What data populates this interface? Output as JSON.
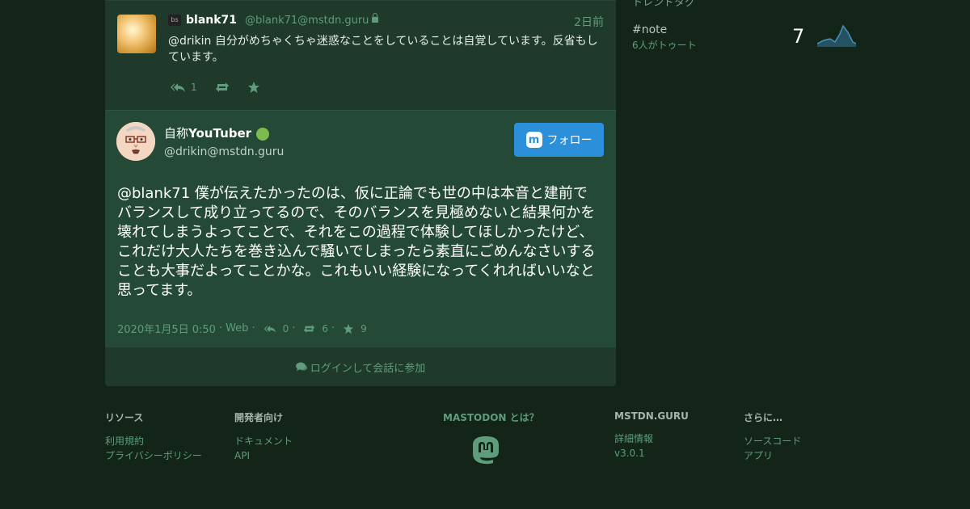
{
  "sidebar": {
    "trend_header": "トレンドタグ",
    "trend": {
      "tag": "#note",
      "sub": "6人がトゥート",
      "count": "7"
    }
  },
  "prev_status": {
    "badge": "bs",
    "display_name": "blank71",
    "acct": "@blank71@mstdn.guru",
    "time": "2日前",
    "content": "@drikin 自分がめちゃくちゃ迷惑なことをしていることは自覚しています。反省もしています。",
    "reply_count": "1"
  },
  "detailed_status": {
    "display_name_prefix": "自称",
    "display_name_bold": "YouTuber",
    "acct": "@drikin@mstdn.guru",
    "follow_label": "フォロー",
    "content": "@blank71 僕が伝えたかったのは、仮に正論でも世の中は本音と建前でバランスして成り立ってるので、そのバランスを見極めないと結果何かを壊れてしまうよってことで、それをこの過程で体験してほしかったけど、これだけ大人たちを巻き込んで騒いでしまったら素直にごめんなさいすることも大事だよってことかな。これもいい経験になってくれればいいなと思ってます。",
    "datetime": "2020年1月5日 0:50",
    "app": "Web",
    "replies": "0",
    "boosts": "6",
    "favourites": "9"
  },
  "login_bar": {
    "label": "ログインして会話に参加"
  },
  "footer": {
    "resources": {
      "title": "リソース",
      "links": [
        "利用規約",
        "プライバシーポリシー"
      ]
    },
    "developers": {
      "title": "開発者向け",
      "links": [
        "ドキュメント",
        "API"
      ]
    },
    "mastodon": {
      "title": "MASTODON とは？"
    },
    "instance": {
      "title": "MSTDN.GURU",
      "links": [
        "詳細情報",
        "v3.0.1"
      ]
    },
    "more": {
      "title": "さらに…",
      "links": [
        "ソースコード",
        "アプリ"
      ]
    }
  },
  "colors": {
    "background": "#132419",
    "panel": "#1f3a2b",
    "detail_panel": "#244a37",
    "accent": "#5f9c7c",
    "follow_button": "#2b90d9"
  }
}
